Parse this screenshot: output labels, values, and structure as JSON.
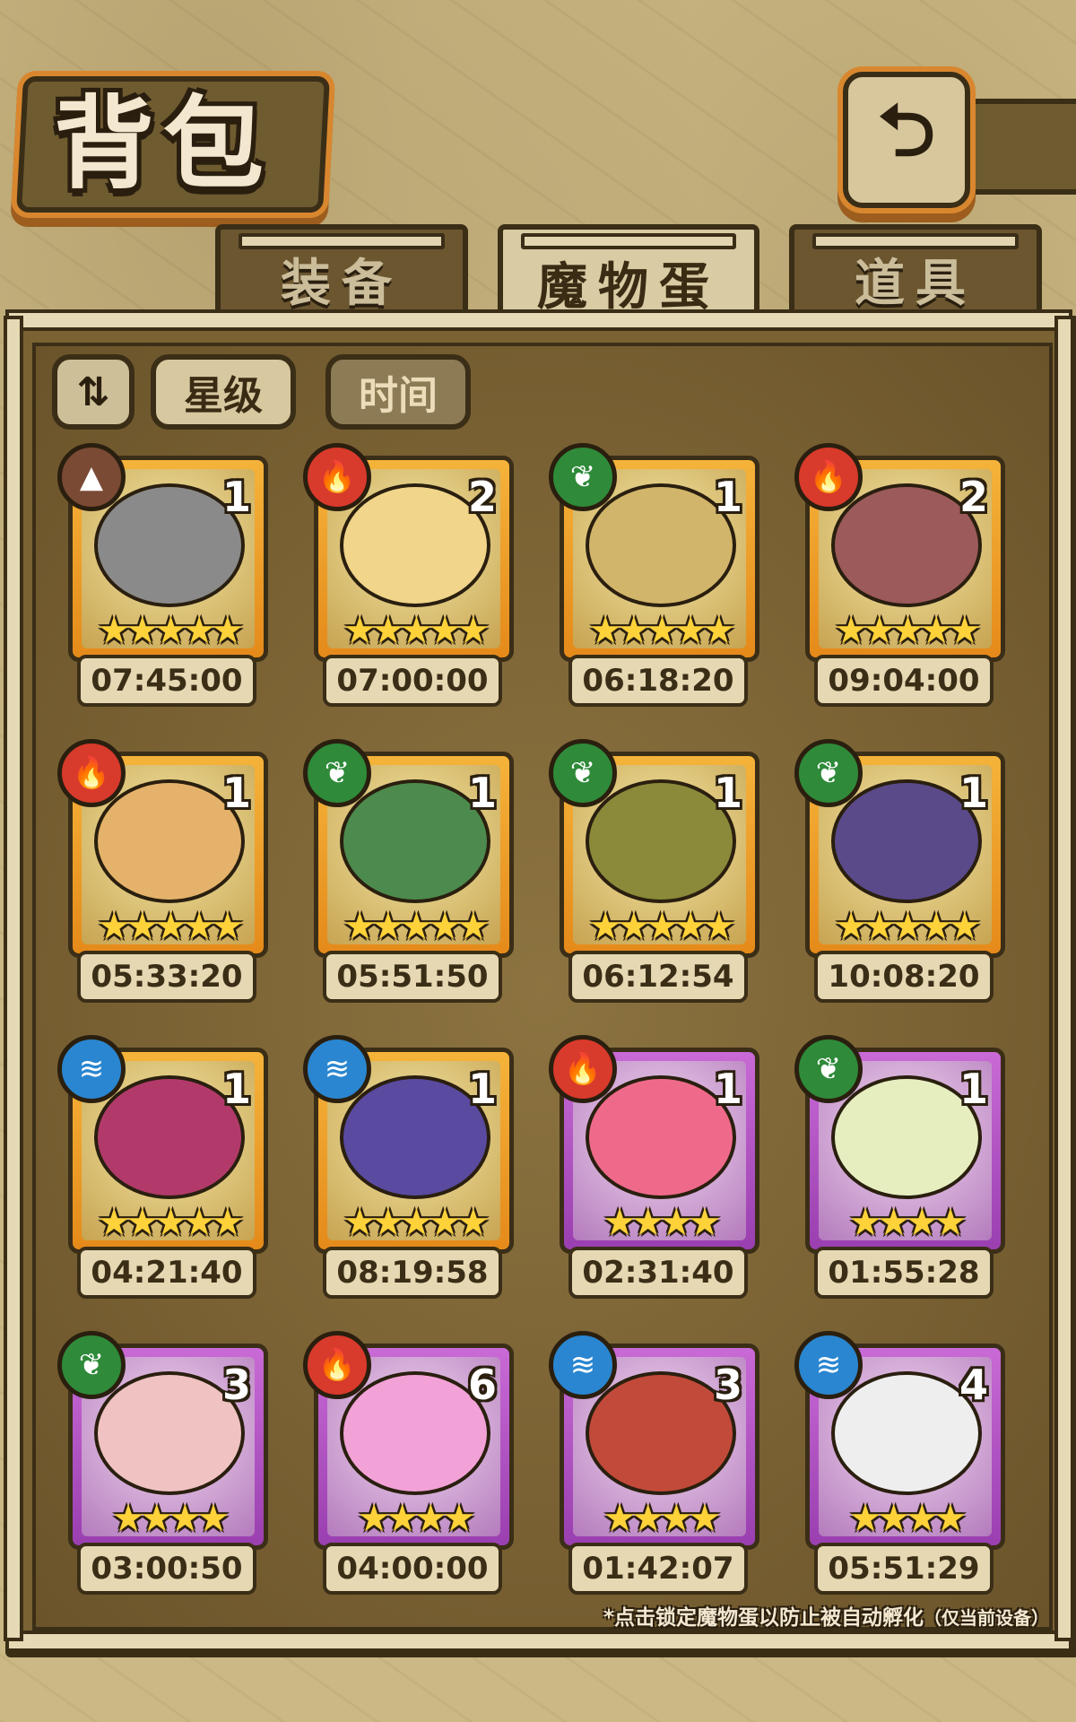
{
  "header": {
    "title": "背包",
    "back_icon": "⮌"
  },
  "tabs": [
    {
      "label": "装备",
      "active": false
    },
    {
      "label": "魔物蛋",
      "active": true
    },
    {
      "label": "道具",
      "active": false
    }
  ],
  "sort": {
    "order_icon": "⇅",
    "star_label": "星级",
    "time_label": "时间"
  },
  "eggs": [
    {
      "element": "earth",
      "count": "1",
      "stars": "★★★★★",
      "rarity": "gold",
      "timer": "07:45:00",
      "color": "#8a8a8a"
    },
    {
      "element": "fire",
      "count": "2",
      "stars": "★★★★★",
      "rarity": "gold",
      "timer": "07:00:00",
      "color": "#f0d58a"
    },
    {
      "element": "nature",
      "count": "1",
      "stars": "★★★★★",
      "rarity": "gold",
      "timer": "06:18:20",
      "color": "#d1b56a"
    },
    {
      "element": "fire",
      "count": "2",
      "stars": "★★★★★",
      "rarity": "gold",
      "timer": "09:04:00",
      "color": "#9c5a5a"
    },
    {
      "element": "fire",
      "count": "1",
      "stars": "★★★★★",
      "rarity": "gold",
      "timer": "05:33:20",
      "color": "#e4b26a"
    },
    {
      "element": "nature",
      "count": "1",
      "stars": "★★★★★",
      "rarity": "gold",
      "timer": "05:51:50",
      "color": "#4d8a4d"
    },
    {
      "element": "nature",
      "count": "1",
      "stars": "★★★★★",
      "rarity": "gold",
      "timer": "06:12:54",
      "color": "#8a8a3a"
    },
    {
      "element": "nature",
      "count": "1",
      "stars": "★★★★★",
      "rarity": "gold",
      "timer": "10:08:20",
      "color": "#5a4a8a"
    },
    {
      "element": "water",
      "count": "1",
      "stars": "★★★★★",
      "rarity": "gold",
      "timer": "04:21:40",
      "color": "#b23a6a"
    },
    {
      "element": "water",
      "count": "1",
      "stars": "★★★★★",
      "rarity": "gold",
      "timer": "08:19:58",
      "color": "#5a4aa0"
    },
    {
      "element": "fire",
      "count": "1",
      "stars": "★★★★",
      "rarity": "purple",
      "timer": "02:31:40",
      "color": "#ef6a8a"
    },
    {
      "element": "nature",
      "count": "1",
      "stars": "★★★★",
      "rarity": "purple",
      "timer": "01:55:28",
      "color": "#e6eec0"
    },
    {
      "element": "nature",
      "count": "3",
      "stars": "★★★★",
      "rarity": "purple",
      "timer": "03:00:50",
      "color": "#f0c2c2"
    },
    {
      "element": "fire",
      "count": "6",
      "stars": "★★★★",
      "rarity": "purple",
      "timer": "04:00:00",
      "color": "#f2a2d6"
    },
    {
      "element": "water",
      "count": "3",
      "stars": "★★★★",
      "rarity": "purple",
      "timer": "01:42:07",
      "color": "#c24a3a"
    },
    {
      "element": "water",
      "count": "4",
      "stars": "★★★★",
      "rarity": "purple",
      "timer": "05:51:29",
      "color": "#eeeeee"
    }
  ],
  "element_icons": {
    "fire": "🔥",
    "nature": "❦",
    "water": "≋",
    "earth": "▲"
  },
  "footnote": {
    "main": "*点击锁定魔物蛋以防止被自动孵化",
    "note": "（仅当前设备）"
  }
}
